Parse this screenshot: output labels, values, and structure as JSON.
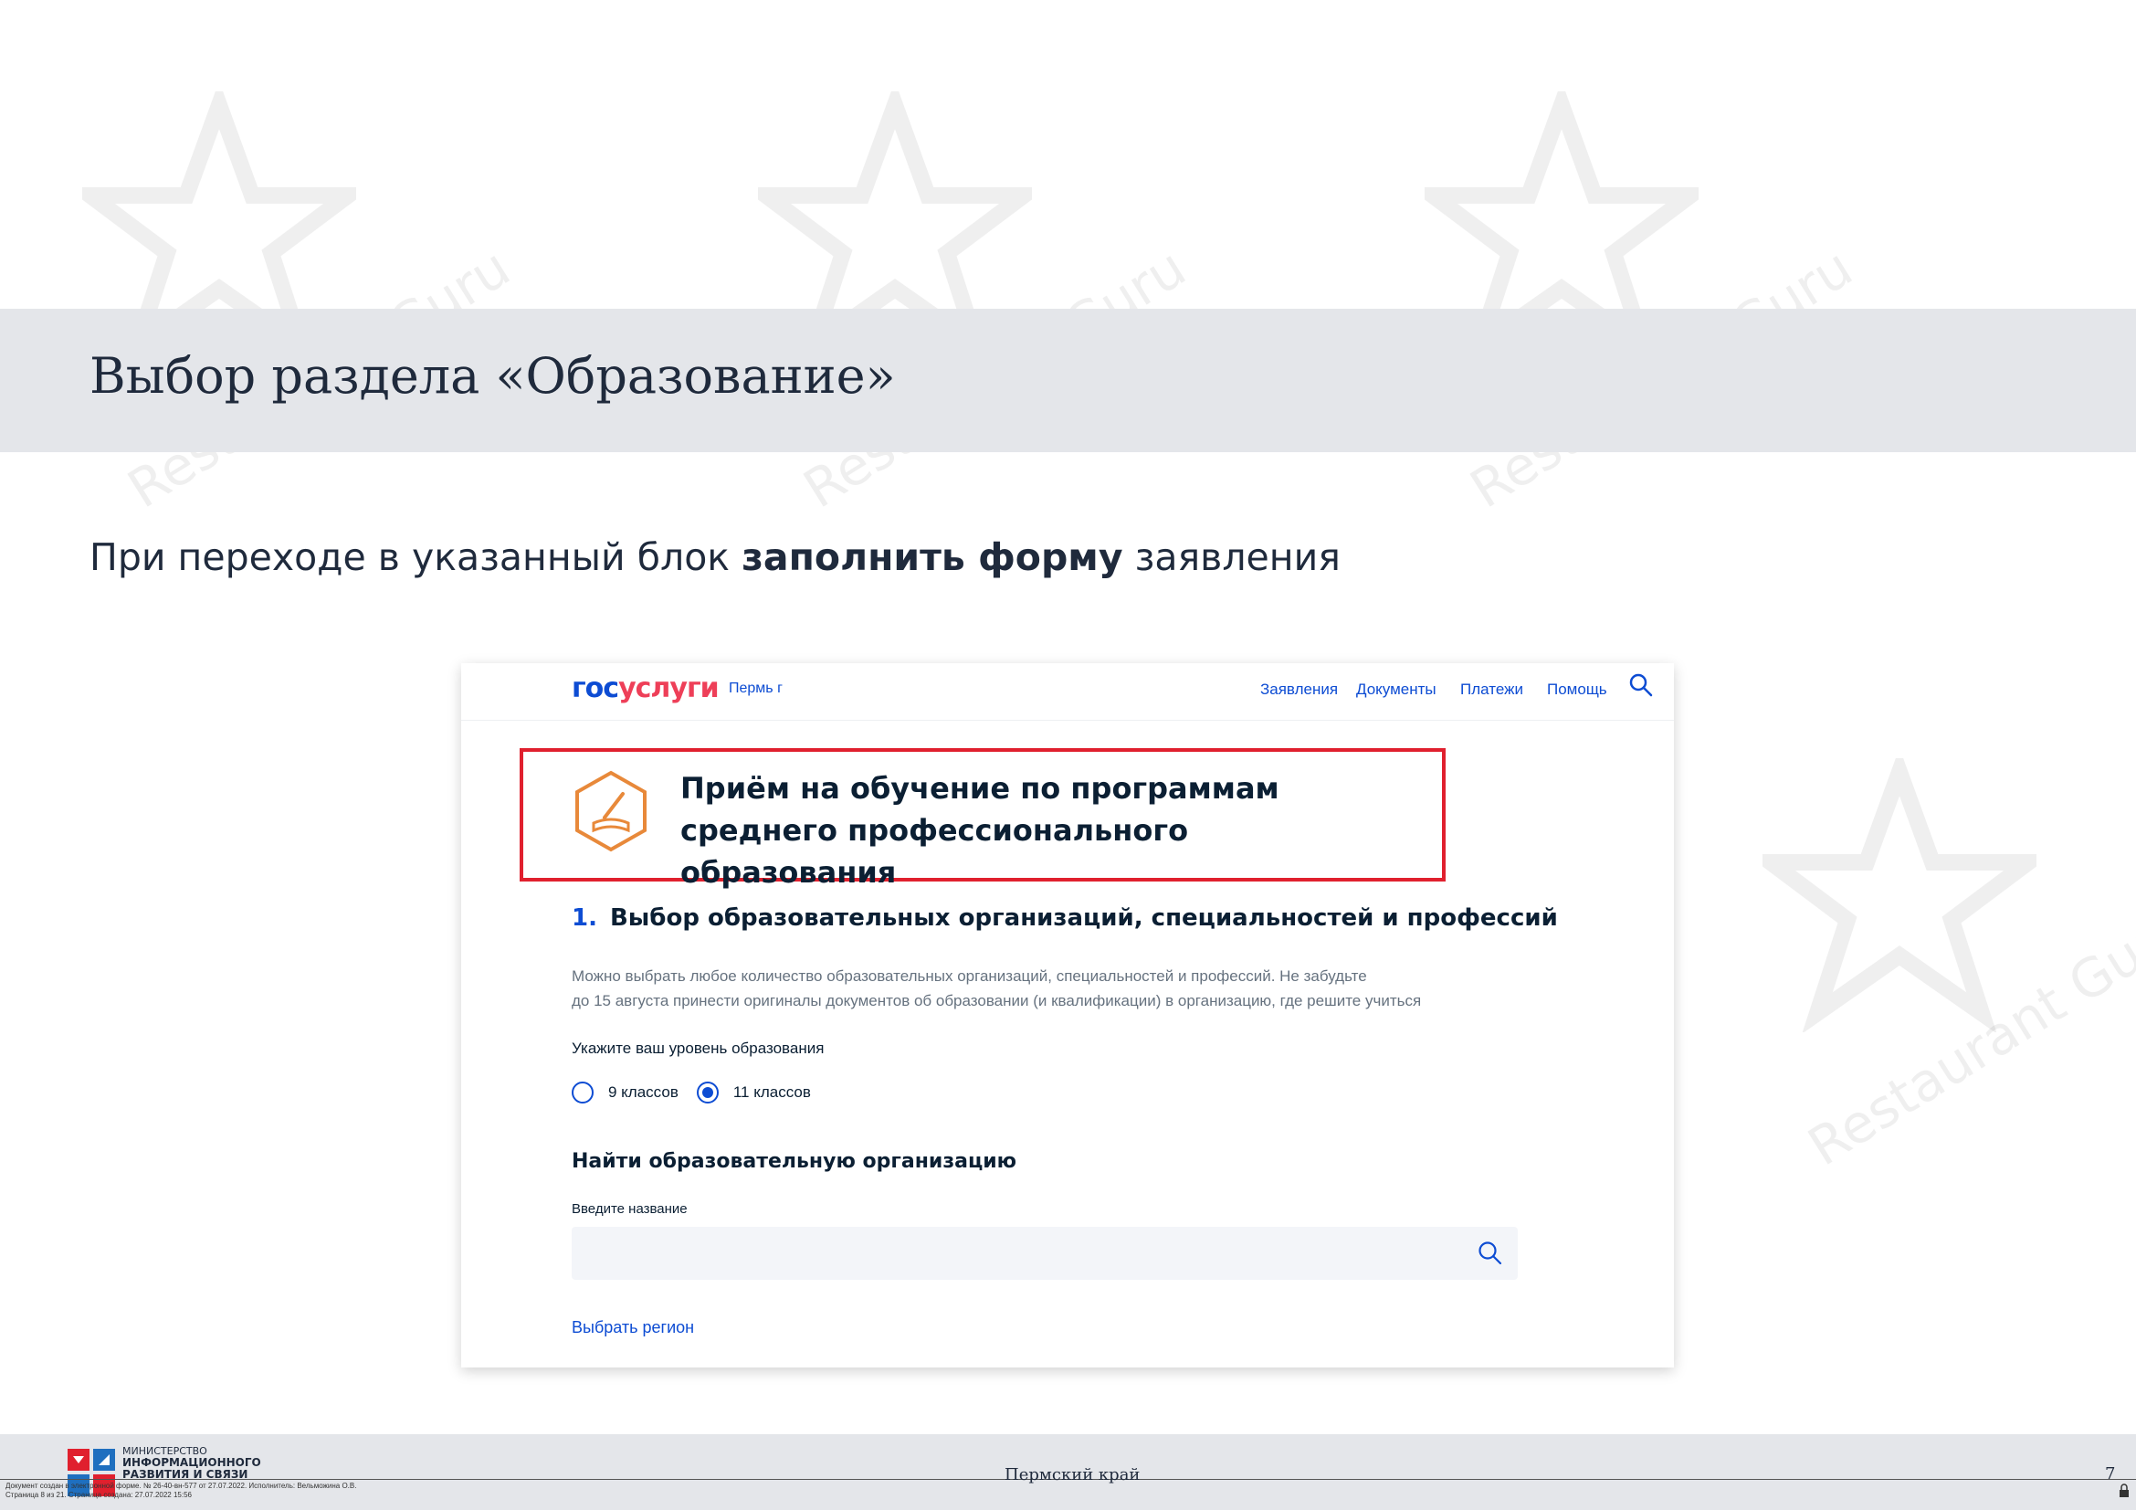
{
  "slide": {
    "title": "Выбор раздела «Образование»",
    "lead_prefix": "При переходе в указанный блок ",
    "lead_bold": "заполнить форму",
    "lead_suffix": " заявления"
  },
  "screenshot": {
    "header": {
      "logo_part1": "гос",
      "logo_part2": "услуги",
      "city": "Пермь г",
      "nav": [
        "Заявления",
        "Документы",
        "Платежи",
        "Помощь"
      ],
      "search_icon": "search-icon"
    },
    "hero": {
      "icon": "diploma-pen-icon",
      "title": "Приём на обучение по программам среднего профессионального образования"
    },
    "step": {
      "number": "1.",
      "title": "Выбор образовательных организаций, специальностей и профессий"
    },
    "description_line1": "Можно выбрать любое количество образовательных организаций, специальностей и профессий. Не забудьте",
    "description_line2": "до 15 августа принести оригиналы документов об образовании (и квалификации) в организацию, где решите учиться",
    "education_level": {
      "label": "Укажите ваш уровень образования",
      "options": [
        "9 классов",
        "11 классов"
      ],
      "selected": "11 классов"
    },
    "find": {
      "title": "Найти образовательную организацию",
      "input_label": "Введите название",
      "input_value": "",
      "input_icon": "search-icon"
    },
    "region_link": "Выбрать регион"
  },
  "footer": {
    "ministry_line1": "МИНИСТЕРСТВО",
    "ministry_line2": "ИНФОРМАЦИОННОГО",
    "ministry_line3": "РАЗВИТИЯ И СВЯЗИ",
    "region": "Пермский край",
    "page": "7",
    "doc_line1": "Документ создан в электронной форме. № 26-40-вн-577 от 27.07.2022. Исполнитель: Вельможина О.В.",
    "doc_line2": "Страница 8 из 21. Страница создана: 27.07.2022 15:56"
  },
  "watermark": "Restaurant Guru",
  "colors": {
    "brand_blue": "#0d4cd3",
    "brand_red": "#ee3f58",
    "highlight_red": "#e0202e",
    "band_gray": "#e4e6ea",
    "icon_orange": "#e8893a"
  }
}
